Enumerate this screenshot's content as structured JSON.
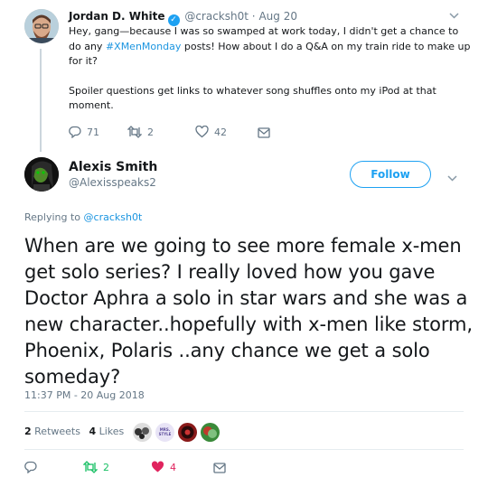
{
  "parent_tweet": {
    "author_name": "Jordan D. White",
    "verified_icon": "verified-badge-icon",
    "handle": "@cracksh0t",
    "date": "Aug 20",
    "separator": "·",
    "text_line1_pre": "Hey, gang—because I was so swamped at work today, I didn't get a chance to do any ",
    "hashtag": "#XMenMonday",
    "text_line1_post": " posts! How about I do a Q&A on my train ride to make up for it?",
    "text_para2": "Spoiler questions get links to whatever song shuffles onto my iPod at that moment.",
    "reply_count": "71",
    "retweet_count": "2",
    "like_count": "42"
  },
  "main_tweet": {
    "author_name": "Alexis Smith",
    "handle": "@Alexisspeaks2",
    "follow_label": "Follow",
    "replying_prefix": "Replying to ",
    "replying_to": "@cracksh0t",
    "text": "When are we going to see more female x-men get solo series? I really loved how you gave Doctor Aphra a solo in star wars and she was a new character..hopefully with x-men like storm, Phoenix, Polaris ..any chance we get a solo someday?",
    "timestamp": "11:37 PM - 20 Aug 2018",
    "retweets_number": "2",
    "retweets_label": "Retweets",
    "likes_number": "4",
    "likes_label": "Likes",
    "retweet_count": "2",
    "like_count": "4",
    "liker_avatar_texts": [
      "MRS. STYLE"
    ]
  },
  "colors": {
    "accent": "#1da1f2",
    "link": "#1b95e0",
    "muted": "#657786",
    "retweet_green": "#17bf63",
    "like_red": "#e0245e"
  }
}
